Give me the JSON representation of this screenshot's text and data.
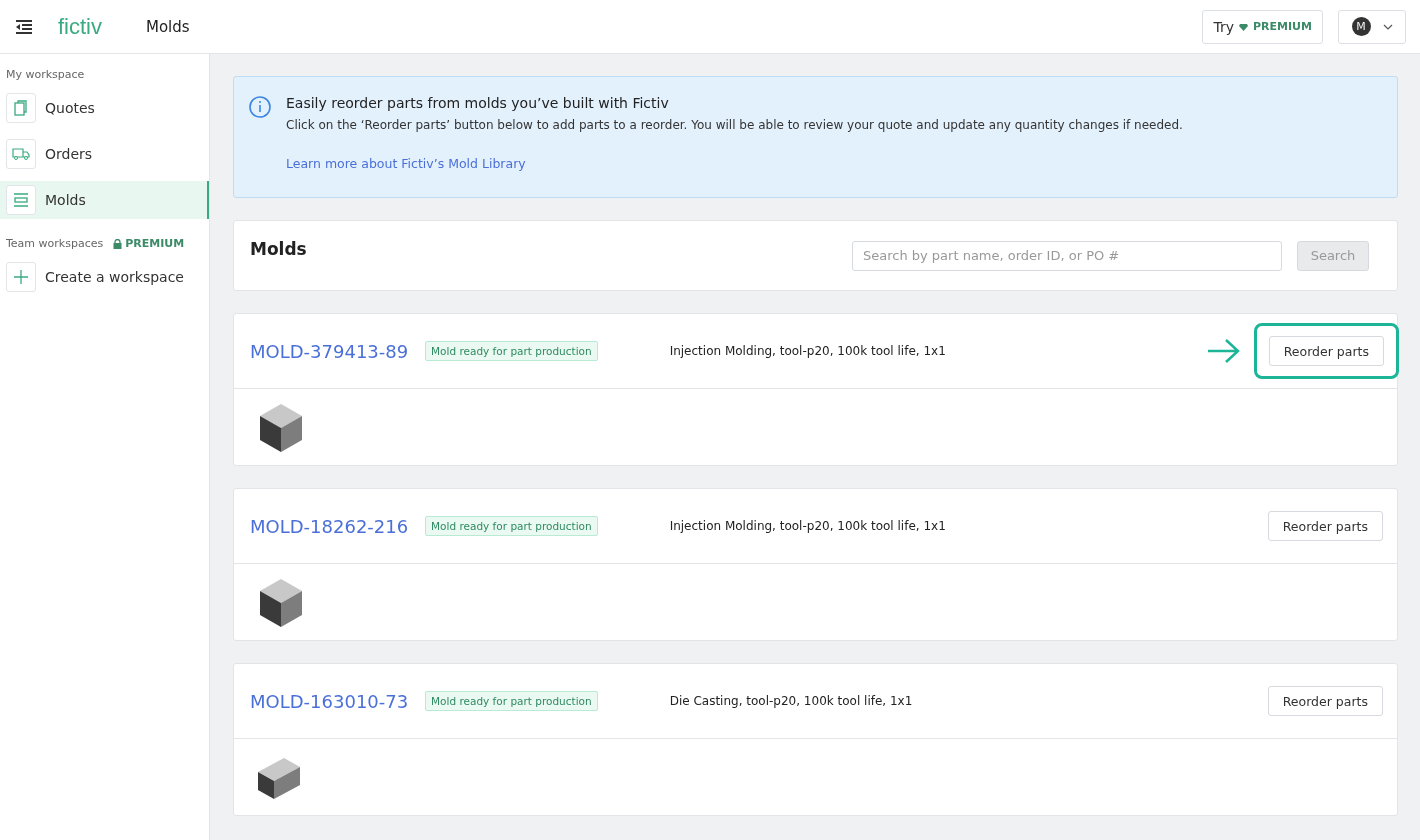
{
  "header": {
    "logo": "fictiv",
    "title": "Molds",
    "premium_button": {
      "try": "Try",
      "label": "PREMIUM"
    },
    "avatar": "M"
  },
  "sidebar": {
    "section": "My workspace",
    "items": [
      {
        "label": "Quotes",
        "selected": false
      },
      {
        "label": "Orders",
        "selected": false
      },
      {
        "label": "Molds",
        "selected": true
      }
    ],
    "team_section": "Team workspaces",
    "team_badge": "PREMIUM",
    "create": "Create a workspace"
  },
  "banner": {
    "title": "Easily reorder parts from molds you’ve built with Fictiv",
    "text": "Click on the ‘Reorder parts’ button below to add parts to a reorder. You will be able to review your quote and update any quantity changes if needed.",
    "link": "Learn more about Fictiv’s Mold Library"
  },
  "molds_panel": {
    "title": "Molds",
    "search": {
      "placeholder": "Search by part name, order ID, or PO #"
    },
    "search_button": "Search"
  },
  "molds": [
    {
      "id": "MOLD-379413-89",
      "status": "Mold ready for part production",
      "spec": "Injection Molding, tool-p20, 100k tool life, 1x1",
      "button": "Reorder parts",
      "highlighted": true,
      "part": {
        "kind": "cube"
      }
    },
    {
      "id": "MOLD-18262-216",
      "status": "Mold ready for part production",
      "spec": "Injection Molding, tool-p20, 100k tool life, 1x1",
      "button": "Reorder parts",
      "highlighted": false,
      "part": {
        "kind": "cube"
      }
    },
    {
      "id": "MOLD-163010-73",
      "status": "Mold ready for part production",
      "spec": "Die Casting, tool-p20, 100k tool life, 1x1",
      "button": "Reorder parts",
      "highlighted": false,
      "part": {
        "kind": "slab"
      }
    }
  ]
}
